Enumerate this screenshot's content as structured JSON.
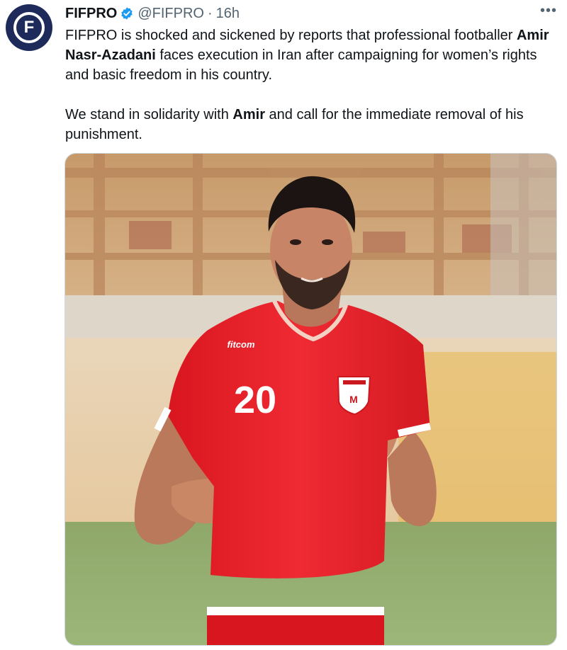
{
  "tweet": {
    "account_name": "FIFPRO",
    "handle": "@FIFPRO",
    "separator": "·",
    "time": "16h",
    "more_label": "•••",
    "avatar_letter": "F",
    "paragraph1": {
      "part1": "FIFPRO is shocked and sickened by reports that professional footballer ",
      "bold1": "Amir Nasr-Azadani",
      "part2": " faces execution in Iran after campaigning for women’s rights and basic freedom in his country."
    },
    "paragraph2": {
      "part1": "We stand in solidarity with ",
      "bold1": "Amir",
      "part2": " and call for the immediate removal of his punishment."
    }
  },
  "photo": {
    "shirt_brand": "fitcom",
    "shirt_number": "20"
  },
  "colors": {
    "avatar_bg": "#1e2a5a",
    "verified": "#1d9bf0",
    "secondary_text": "#536471",
    "jersey_red": "#e8202a"
  }
}
